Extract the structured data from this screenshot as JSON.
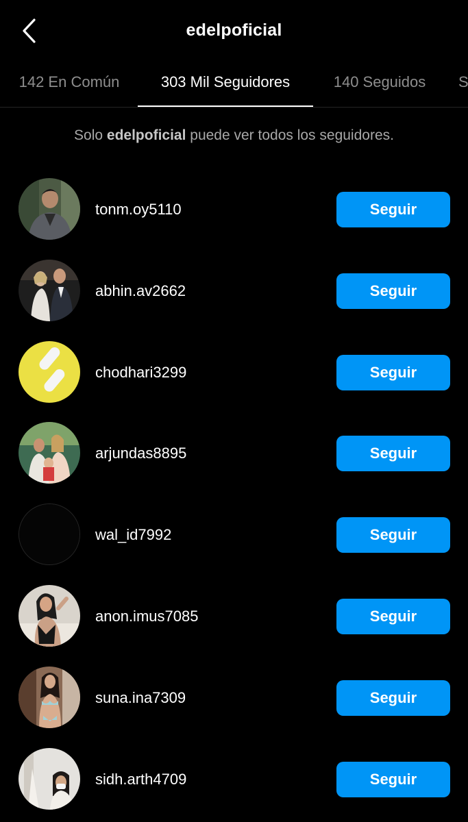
{
  "header": {
    "title": "edelpoficial",
    "back_icon": "chevron-left-icon"
  },
  "tabs": [
    {
      "label": "142 En Común"
    },
    {
      "label": "303 Mil Seguidores",
      "active": true
    },
    {
      "label": "140 Seguidos"
    },
    {
      "label": "S"
    }
  ],
  "notice": {
    "prefix": "Solo ",
    "name": "edelpoficial",
    "suffix": " puede ver todos los seguidores."
  },
  "followers": [
    {
      "username": "tonm.oy5110",
      "button": "Seguir"
    },
    {
      "username": "abhin.av2662",
      "button": "Seguir"
    },
    {
      "username": "chodhari3299",
      "button": "Seguir"
    },
    {
      "username": "arjundas8895",
      "button": "Seguir"
    },
    {
      "username": "wal_id7992",
      "button": "Seguir"
    },
    {
      "username": "anon.imus7085",
      "button": "Seguir"
    },
    {
      "username": "suna.ina7309",
      "button": "Seguir"
    },
    {
      "username": "sidh.arth4709",
      "button": "Seguir"
    }
  ],
  "colors": {
    "background": "#000000",
    "accent": "#0095f6",
    "muted_text": "#8e8e8e"
  }
}
